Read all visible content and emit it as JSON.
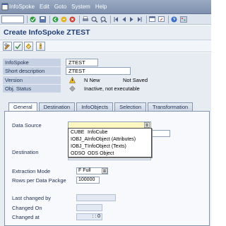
{
  "menu": {
    "items": [
      "InfoSpoke",
      "Edit",
      "Goto",
      "System",
      "Help"
    ]
  },
  "page": {
    "title": "Create InfoSpoke ZTEST"
  },
  "header_fields": {
    "infospoke": {
      "label": "InfoSpoke",
      "value": "ZTEST"
    },
    "short_description": {
      "label": "Short description",
      "value": "ZTEST"
    },
    "version": {
      "label": "Version",
      "status": "N New",
      "saved": "Not Saved"
    },
    "obj_status": {
      "label": "Obj. Status",
      "value": "Inactive, not executable"
    }
  },
  "tabs": [
    {
      "label": "General",
      "active": true
    },
    {
      "label": "Destination",
      "active": false
    },
    {
      "label": "InfoObjects",
      "active": false
    },
    {
      "label": "Selection",
      "active": false
    },
    {
      "label": "Transformation",
      "active": false
    }
  ],
  "general": {
    "data_source": {
      "label": "Data Source",
      "value": ""
    },
    "destination": {
      "label": "Destination",
      "value": ""
    },
    "extraction_mode": {
      "label": "Extraction Mode",
      "value": "F Full"
    },
    "rows_per_package": {
      "label": "Rows per Data Packge",
      "value": "100000"
    },
    "last_changed_by": {
      "label": "Last changed by",
      "value": ""
    },
    "changed_on": {
      "label": "Changed On",
      "value": ""
    },
    "changed_at": {
      "label": "Changed at",
      "value": ":   :  0"
    }
  },
  "data_source_dropdown": {
    "options": [
      {
        "code": "CUBE",
        "desc": "InfoCube"
      },
      {
        "code": "IOBJ_A",
        "desc": "InfoObject (Attributes)"
      },
      {
        "code": "IOBJ_T",
        "desc": "InfoObject (Texts)"
      },
      {
        "code": "ODSO",
        "desc": "ODS Object"
      }
    ]
  },
  "colors": {
    "menubar": "#8e9fb9",
    "title": "#1f3f78",
    "required_field": "#fff7c2",
    "label_cell": "#c6d2e3"
  },
  "icons": {
    "version_status": "warning-triangle-icon",
    "obj_status": "inactive-diamond-icon"
  }
}
